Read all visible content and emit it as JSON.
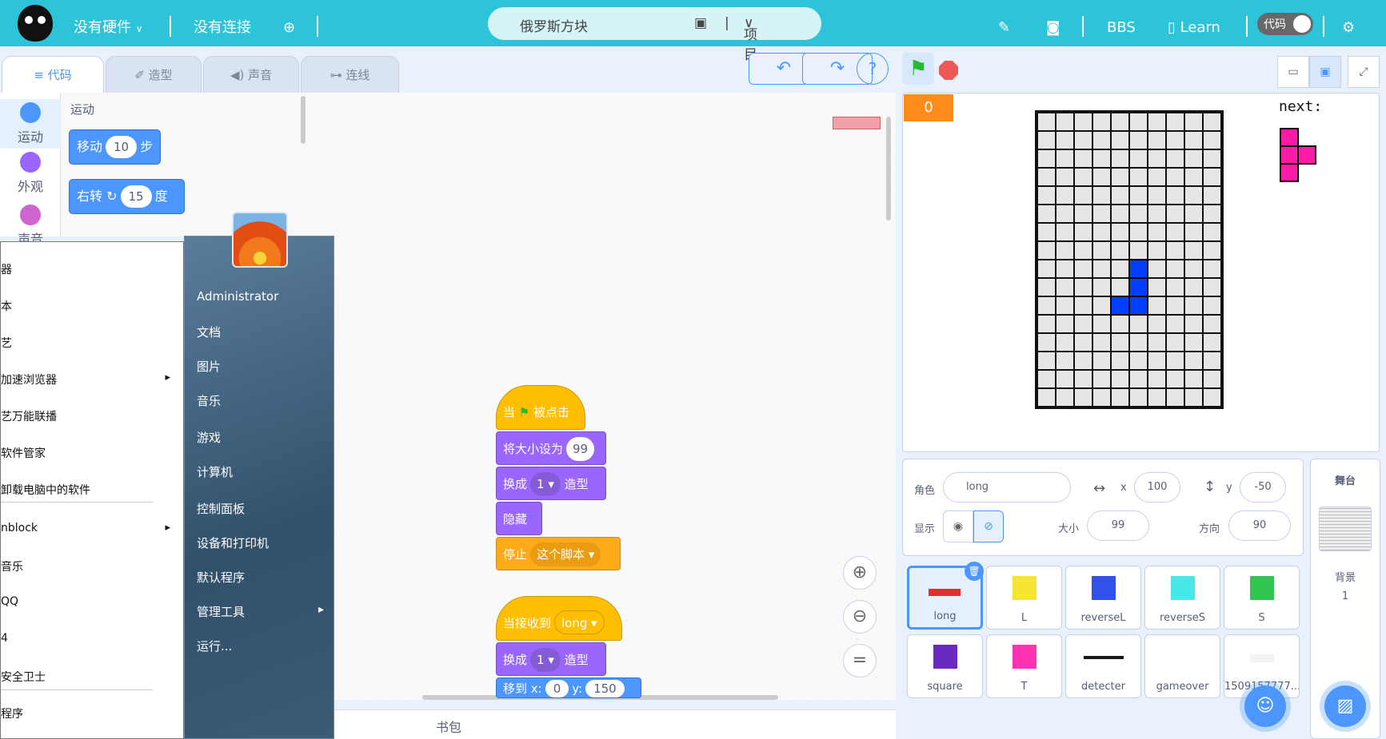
{
  "topbar": {
    "hardware": "没有硬件",
    "connection": "没有连接",
    "project_title": "俄罗斯方块",
    "project_menu": "项目",
    "bbs": "BBS",
    "learn": "Learn",
    "code_toggle": "代码"
  },
  "tabs": [
    {
      "label": "代码"
    },
    {
      "label": "造型"
    },
    {
      "label": "声音"
    },
    {
      "label": "连线"
    }
  ],
  "categories": [
    {
      "label": "运动",
      "color": "#4c97ff"
    },
    {
      "label": "外观",
      "color": "#9966ff"
    },
    {
      "label": "声音",
      "color": "#cf63cf"
    }
  ],
  "palette": {
    "heading": "运动",
    "move": {
      "text": "移动",
      "value": "10",
      "unit": "步"
    },
    "turn": {
      "text": "右转",
      "value": "15",
      "unit": "度"
    }
  },
  "scripts": {
    "s1": {
      "hat_pre": "当",
      "hat_post": "被点击",
      "setsize": "将大小设为",
      "setsize_val": "99",
      "switch": "换成",
      "switch_val": "1",
      "switch_post": "造型",
      "hide": "隐藏",
      "stop": "停止",
      "stop_val": "这个脚本"
    },
    "s2": {
      "hat": "当接收到",
      "hat_val": "long",
      "switch": "换成",
      "switch_val": "1",
      "switch_post": "造型",
      "goto": "移到 x:",
      "x_val": "0",
      "y_label": "y:",
      "y_val": "150"
    }
  },
  "backpack": "书包",
  "stage": {
    "score": "0",
    "next_label": "next:",
    "grid_cols": 10,
    "grid_rows": 16,
    "active_piece": [
      [
        5,
        8
      ],
      [
        5,
        9
      ],
      [
        4,
        10
      ],
      [
        5,
        10
      ]
    ],
    "active_color": "#0040ff",
    "next_color": "#ff1aa8"
  },
  "sprite_info": {
    "sprite_label": "角色",
    "sprite_name": "long",
    "x_label": "x",
    "x": "100",
    "y_label": "y",
    "y": "-50",
    "show_label": "显示",
    "size_label": "大小",
    "size": "99",
    "dir_label": "方向",
    "dir": "90"
  },
  "sprites": [
    {
      "name": "long",
      "color": "#e8161b"
    },
    {
      "name": "L",
      "color": "#f5e31b"
    },
    {
      "name": "reverseL",
      "color": "#1a3fe8"
    },
    {
      "name": "reverseS",
      "color": "#34e6e6"
    },
    {
      "name": "S",
      "color": "#1bbf3c"
    },
    {
      "name": "square",
      "color": "#5a12b8"
    },
    {
      "name": "T",
      "color": "#ff1aa8"
    },
    {
      "name": "detecter",
      "color": "#000000"
    },
    {
      "name": "gameover",
      "color": "#ff4444"
    },
    {
      "name": "1509157777...",
      "color": "#cccccc"
    }
  ],
  "stage_pane": {
    "title": "舞台",
    "backdrop_label": "背景",
    "backdrop_count": "1"
  },
  "start_menu": {
    "left_items": [
      "器",
      "本",
      "艺",
      "加速浏览器",
      "艺万能联播",
      "软件管家",
      "卸载电脑中的软件",
      "nblock",
      "音乐",
      "QQ",
      "4",
      "安全卫士",
      "程序"
    ],
    "right_items": [
      "Administrator",
      "文档",
      "图片",
      "音乐",
      "游戏",
      "计算机",
      "控制面板",
      "设备和打印机",
      "默认程序",
      "管理工具",
      "运行..."
    ]
  }
}
